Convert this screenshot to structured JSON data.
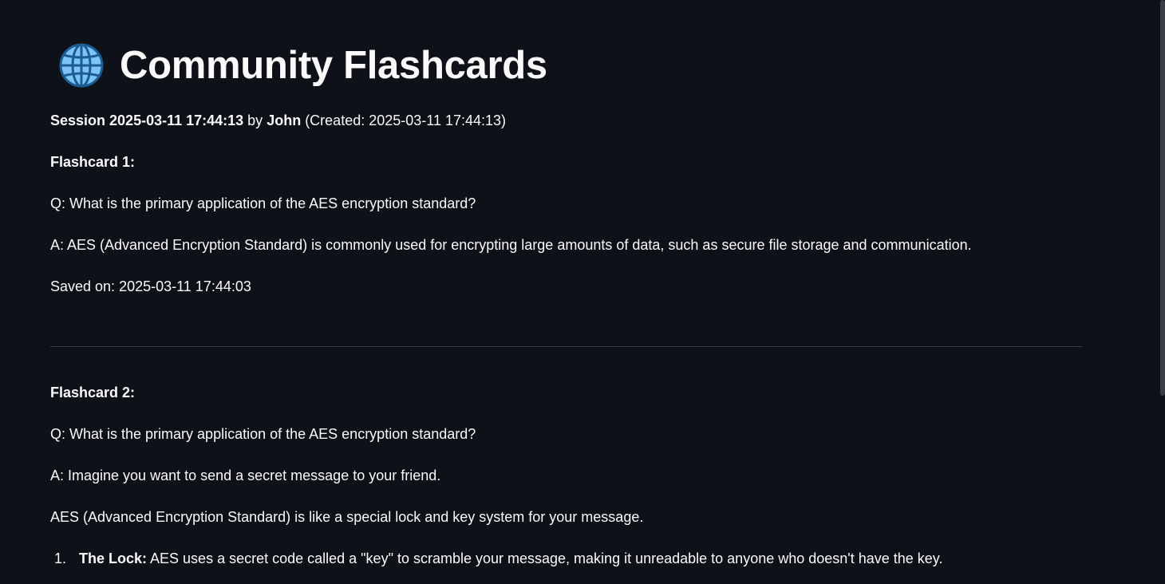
{
  "header": {
    "title": "Community Flashcards",
    "icon": "globe-icon"
  },
  "session": {
    "label": "Session 2025-03-11 17:44:13",
    "by_text": " by ",
    "author": "John",
    "created_text": " (Created: 2025-03-11 17:44:13)"
  },
  "flashcards": [
    {
      "heading": "Flashcard 1:",
      "question": "Q: What is the primary application of the AES encryption standard?",
      "answer": "A: AES (Advanced Encryption Standard) is commonly used for encrypting large amounts of data, such as secure file storage and communication.",
      "saved_on": "Saved on: 2025-03-11 17:44:03"
    },
    {
      "heading": "Flashcard 2:",
      "question": "Q: What is the primary application of the AES encryption standard?",
      "answer": "A: Imagine you want to send a secret message to your friend.",
      "answer_para2": "AES (Advanced Encryption Standard) is like a special lock and key system for your message.",
      "list": [
        {
          "number": "1.",
          "term": "The Lock:",
          "text": " AES uses a secret code called a \"key\" to scramble your message, making it unreadable to anyone who doesn't have the key."
        }
      ]
    }
  ],
  "colors": {
    "background": "#0e1117",
    "text": "#fafafa",
    "divider": "#3a3d46",
    "globe": "#7cc4f8"
  }
}
